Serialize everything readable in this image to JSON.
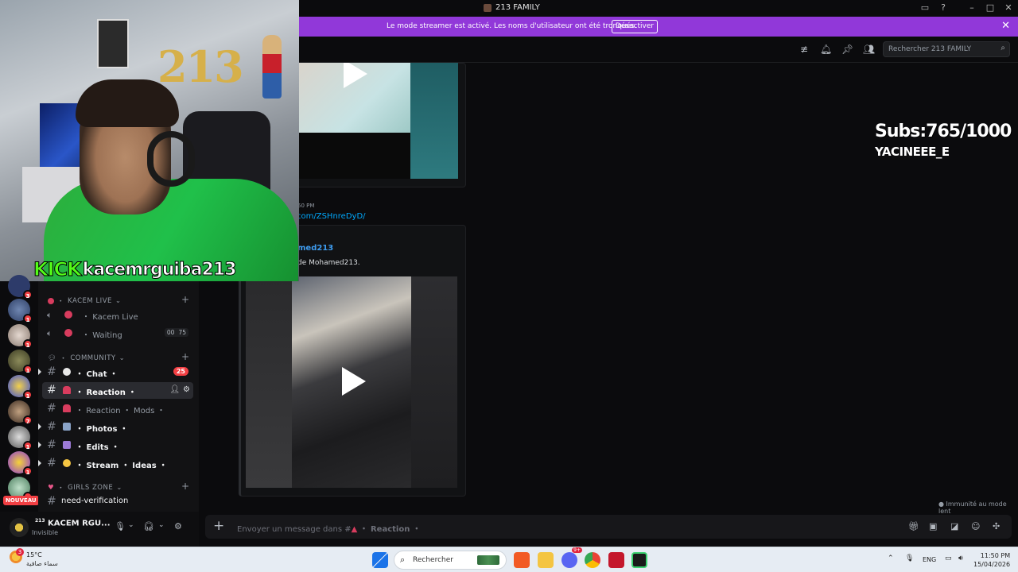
{
  "window": {
    "title": "213 FAMILY"
  },
  "banner": {
    "message": "Le mode streamer est activé. Les noms d'utilisateur ont été tronqués.",
    "button": "Désactiver"
  },
  "search": {
    "placeholder": "Rechercher 213 FAMILY"
  },
  "overlay": {
    "kick_brand": "KICK",
    "kick_user": "kacemrguiba213",
    "subs": "Subs:765/1000",
    "handle": "YACINEEE_E"
  },
  "servers": [
    {
      "badge": "3"
    },
    {
      "badge": "1"
    },
    {
      "badge": "1"
    },
    {
      "badge": "1"
    },
    {
      "badge": "1"
    },
    {
      "badge": "7"
    },
    {
      "badge": "1"
    },
    {
      "badge": "1"
    },
    {
      "badge": "1"
    }
  ],
  "nouveau_label": "NOUVEAU",
  "categories": {
    "kacem_live": "KACEM LIVE",
    "community": "COMMUNITY",
    "girls_zone": "GIRLS ZONE"
  },
  "voice_channels": [
    {
      "label": "Kacem Live"
    },
    {
      "label": "Waiting",
      "counter_a": "00",
      "counter_b": "75"
    }
  ],
  "text_channels": [
    {
      "label": "Chat",
      "badge": "25"
    },
    {
      "label": "Reaction"
    },
    {
      "label": "Reaction ・ Mods"
    },
    {
      "label": "Photos"
    },
    {
      "label": "Edits"
    },
    {
      "label": "Stream ・ Ideas"
    },
    {
      "label": "need-verification"
    }
  ],
  "user": {
    "tag": "213",
    "name": "KACEM RGU...",
    "status": "Invisible"
  },
  "messages": {
    "time": "50 PM",
    "link": "com/ZSHnreDyD/",
    "author": "med213",
    "description": "de Mohamed213."
  },
  "immunity": "Immunité au mode lent",
  "composer": {
    "placeholder": "Envoyer un message dans #",
    "channel": "・ Reaction ・"
  },
  "taskbar": {
    "temp": "15°C",
    "condition": "سماء صافية",
    "weather_badge": "3",
    "search": "Rechercher",
    "lang": "ENG",
    "time": "11:50 PM",
    "date": "15/04/2026",
    "discord_badge": "9+"
  }
}
